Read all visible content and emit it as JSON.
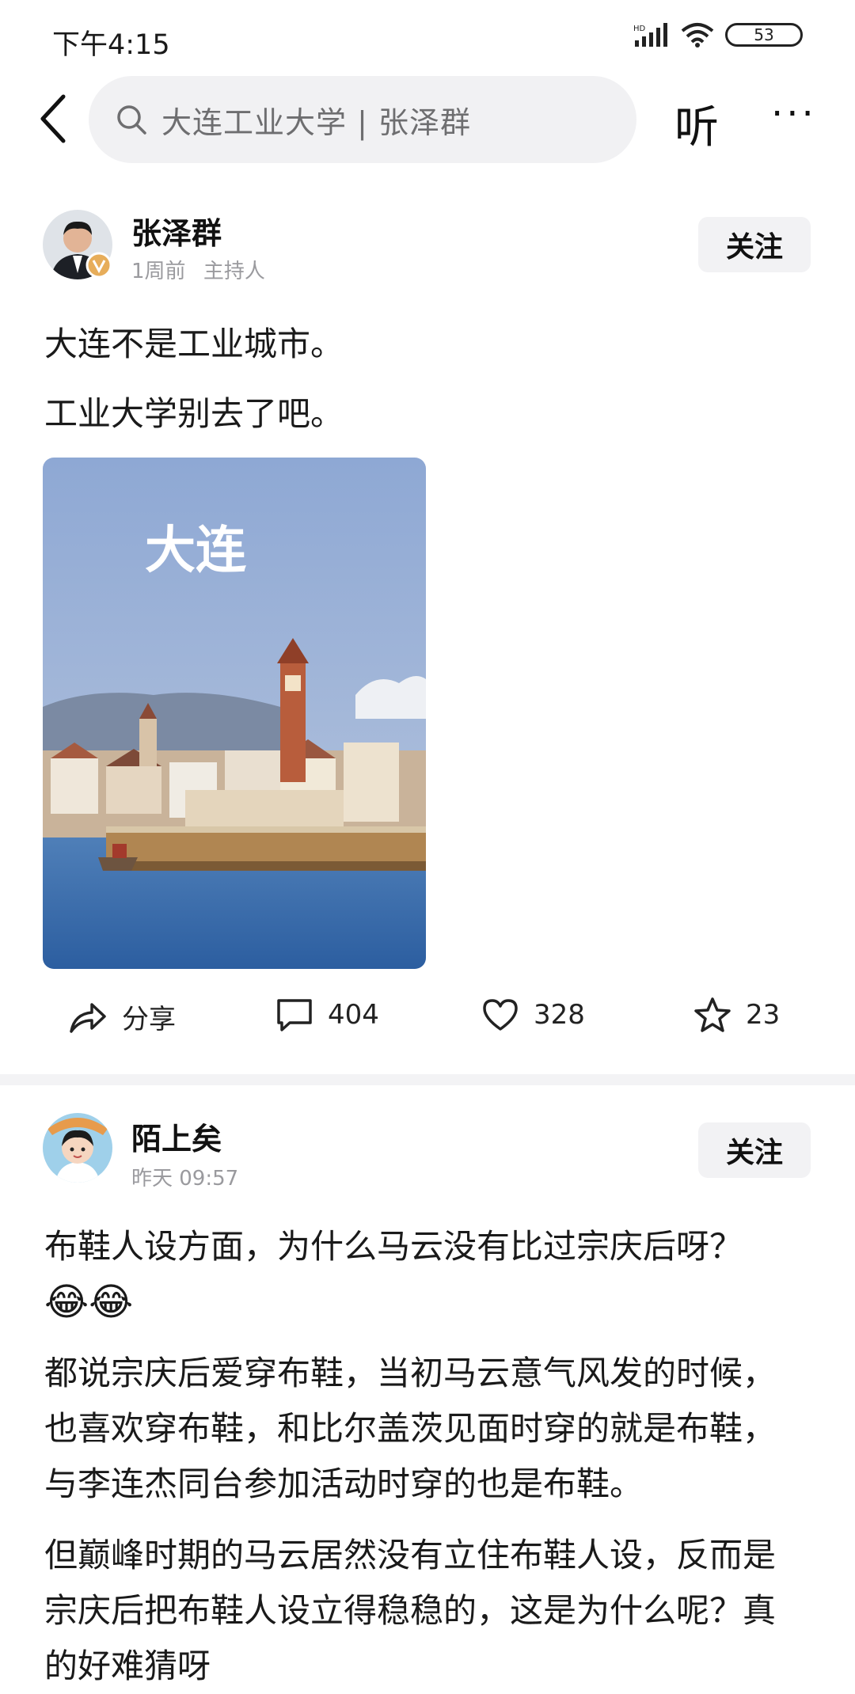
{
  "status_bar": {
    "time": "下午4:15",
    "battery": "53"
  },
  "top_bar": {
    "search_text": "大连工业大学 | 张泽群",
    "listen": "听",
    "more": "···"
  },
  "post1": {
    "author": "张泽群",
    "time": "1周前",
    "role": "主持人",
    "follow": "关注",
    "text_line1": "大连不是工业城市。",
    "text_line2": "工业大学别去了吧。",
    "image_caption": "大连",
    "actions": {
      "share": "分享",
      "comments": "404",
      "likes": "328",
      "favorites": "23"
    }
  },
  "post2": {
    "author": "陌上矣",
    "time": "昨天  09:57",
    "follow": "关注",
    "para1_line1": "布鞋人设方面，为什么马云没有比过宗庆后呀？",
    "emoji": "😂😂",
    "para2_line1": "都说宗庆后爱穿布鞋，当初马云意气风发的时候，",
    "para2_line2": "也喜欢穿布鞋，和比尔盖茨见面时穿的就是布鞋，",
    "para2_line3": "与李连杰同台参加活动时穿的也是布鞋。",
    "para3_line1": "但巅峰时期的马云居然没有立住布鞋人设，反而是",
    "para3_line2": "宗庆后把布鞋人设立得稳稳的，这是为什么呢？真",
    "para3_line3": "的好难猜呀"
  },
  "colors": {
    "search_bg": "#f1f1f3",
    "follow_bg": "#f2f2f4",
    "meta_gray": "#9a9a9e"
  }
}
